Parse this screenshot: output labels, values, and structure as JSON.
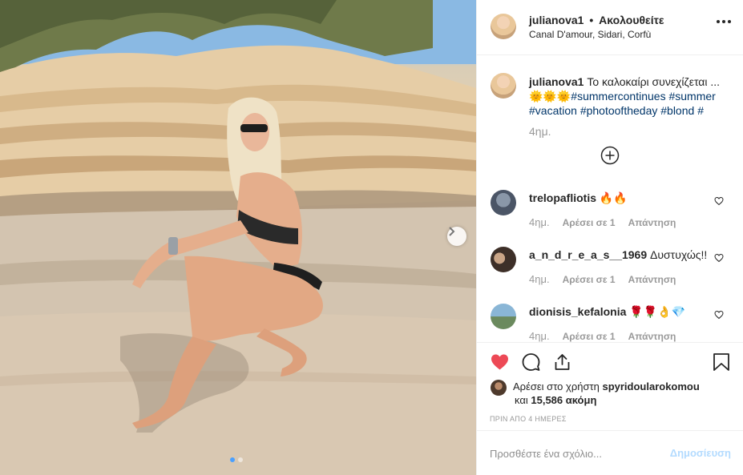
{
  "post": {
    "author": "julianova1",
    "separator": "•",
    "follow_status": "Ακολουθείτε",
    "location": "Canal D'amour, Sidari, Corfù"
  },
  "caption": {
    "user": "julianova1",
    "text": "Το καλοκαίρι συνεχίζεται ...",
    "emojis": "🌞🌞🌞",
    "hashtags": [
      "#summercontinues",
      "#summer",
      "#vacation",
      "#photooftheday",
      "#blond",
      "#"
    ],
    "time": "4ημ."
  },
  "comments": [
    {
      "user": "trelopafliotis",
      "text": "🔥🔥",
      "time": "4ημ.",
      "likes_label": "Αρέσει σε 1",
      "reply_label": "Απάντηση"
    },
    {
      "user": "a_n_d_r_e_a_s__1969",
      "text": "Δυστυχώς!!",
      "time": "4ημ.",
      "likes_label": "Αρέσει σε 1",
      "reply_label": "Απάντηση"
    },
    {
      "user": "dionisis_kefalonia",
      "text": "🌹🌹👌💎",
      "time": "4ημ.",
      "likes_label": "Αρέσει σε 1",
      "reply_label": "Απάντηση"
    }
  ],
  "likes": {
    "prefix": "Αρέσει στο χρήστη",
    "user": "spyridoularokomou",
    "and": "και",
    "count": "15,586 ακόμη"
  },
  "posted_time": "ΠΡΙΝ ΑΠΟ 4 ΗΜΕΡΕΣ",
  "add_comment": {
    "placeholder": "Προσθέστε ένα σχόλιο...",
    "post_label": "Δημοσίευση"
  },
  "icons": {
    "like": "heart-filled-icon",
    "comment": "speech-bubble-icon",
    "share": "share-icon",
    "save": "bookmark-icon",
    "more": "more-options-icon",
    "next": "chevron-right-icon",
    "load_more": "plus-circle-icon"
  },
  "colors": {
    "like_red": "#ed4956",
    "hashtag": "#003569",
    "post_button_disabled": "#b3dbff",
    "meta_grey": "#999999"
  },
  "carousel": {
    "current": 1,
    "total": 2
  }
}
